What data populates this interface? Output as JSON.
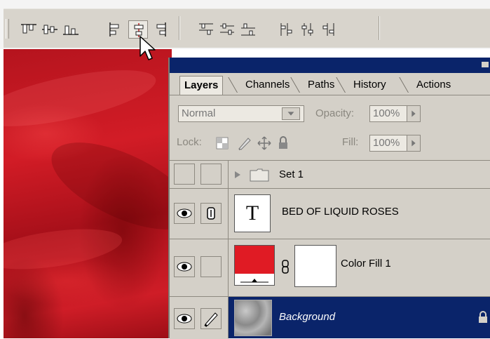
{
  "toolbar": {
    "buttons": [
      {
        "icon": "align-top-edges-icon"
      },
      {
        "icon": "align-vertical-centers-icon"
      },
      {
        "icon": "align-bottom-edges-icon"
      },
      {
        "icon": "align-left-edges-icon"
      },
      {
        "icon": "align-horizontal-centers-icon",
        "pressed": true
      },
      {
        "icon": "align-right-edges-icon"
      },
      {
        "icon": "distribute-top-edges-icon"
      },
      {
        "icon": "distribute-vertical-centers-icon"
      },
      {
        "icon": "distribute-bottom-edges-icon"
      },
      {
        "icon": "distribute-left-edges-icon"
      },
      {
        "icon": "distribute-horizontal-centers-icon"
      },
      {
        "icon": "distribute-right-edges-icon"
      }
    ]
  },
  "panel": {
    "tabs": [
      "Layers",
      "Channels",
      "Paths",
      "History",
      "Actions"
    ],
    "active_tab": "Layers",
    "blend_mode": "Normal",
    "opacity_label": "Opacity:",
    "opacity_value": "100%",
    "lock_label": "Lock:",
    "fill_label": "Fill:",
    "fill_value": "100%"
  },
  "layers": [
    {
      "name": "Set 1",
      "type": "group",
      "visible": false
    },
    {
      "name": "BED OF LIQUID ROSES",
      "type": "text",
      "visible": true,
      "thumb_text": "T"
    },
    {
      "name": "Color Fill 1",
      "type": "fill",
      "visible": true,
      "fill_color": "#e01b24"
    },
    {
      "name": "Background",
      "type": "image",
      "visible": true,
      "selected": true,
      "locked": true
    }
  ],
  "colors": {
    "title_bar": "#0a246a",
    "selection": "#0a246a",
    "panel_bg": "#d4d0c8"
  }
}
